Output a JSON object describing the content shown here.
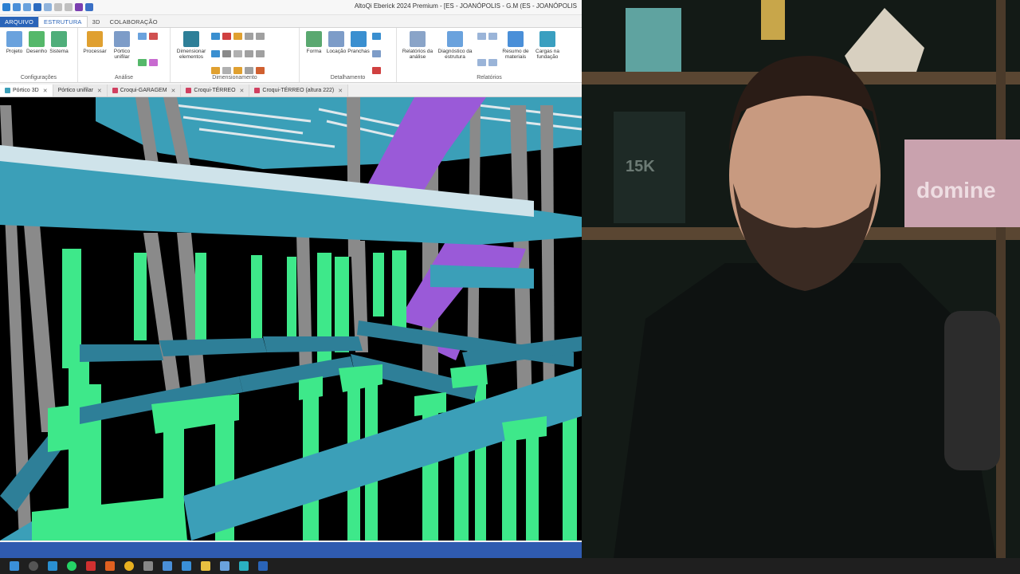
{
  "window": {
    "title": "AltoQi Eberick 2024 Premium - [ES - JOANÓPOLIS - G.M (ES - JOANÓPOLIS"
  },
  "ribbon_tabs": [
    "ARQUIVO",
    "ESTRUTURA",
    "3D",
    "COLABORAÇÃO"
  ],
  "ribbon": {
    "configuracoes": {
      "label": "Configurações",
      "buttons": [
        "Projeto",
        "Desenho",
        "Sistema"
      ]
    },
    "analise": {
      "label": "Análise",
      "buttons": [
        "Processar",
        "Pórtico unifilar"
      ]
    },
    "dimensionamento": {
      "label": "Dimensionamento",
      "buttons": [
        "Dimensionar elementos"
      ]
    },
    "detalhamento": {
      "label": "Detalhamento",
      "buttons": [
        "Forma",
        "Locação",
        "Pranchas"
      ]
    },
    "relatorios": {
      "label": "Relatórios",
      "buttons": [
        "Relatórios da análise",
        "Diagnóstico da estrutura",
        "Resumo de materiais",
        "Cargas na fundação"
      ]
    }
  },
  "doc_tabs": [
    "Pórtico 3D",
    "Pórtico unifilar",
    "Croqui-GARAGEM",
    "Croqui-TÉRREO",
    "Croqui-TÉRREO (altura 222)"
  ],
  "colors": {
    "file_tab": "#2a64b8",
    "beam": "#3b9fb8",
    "column": "#3ee88a",
    "stair": "#9a5ad8",
    "pillar": "#8a8a8a",
    "background3d": "#000000",
    "statusbar": "#2f5bb0"
  },
  "webcam": {
    "shelf_sign": "domine",
    "book_label": "15K"
  }
}
